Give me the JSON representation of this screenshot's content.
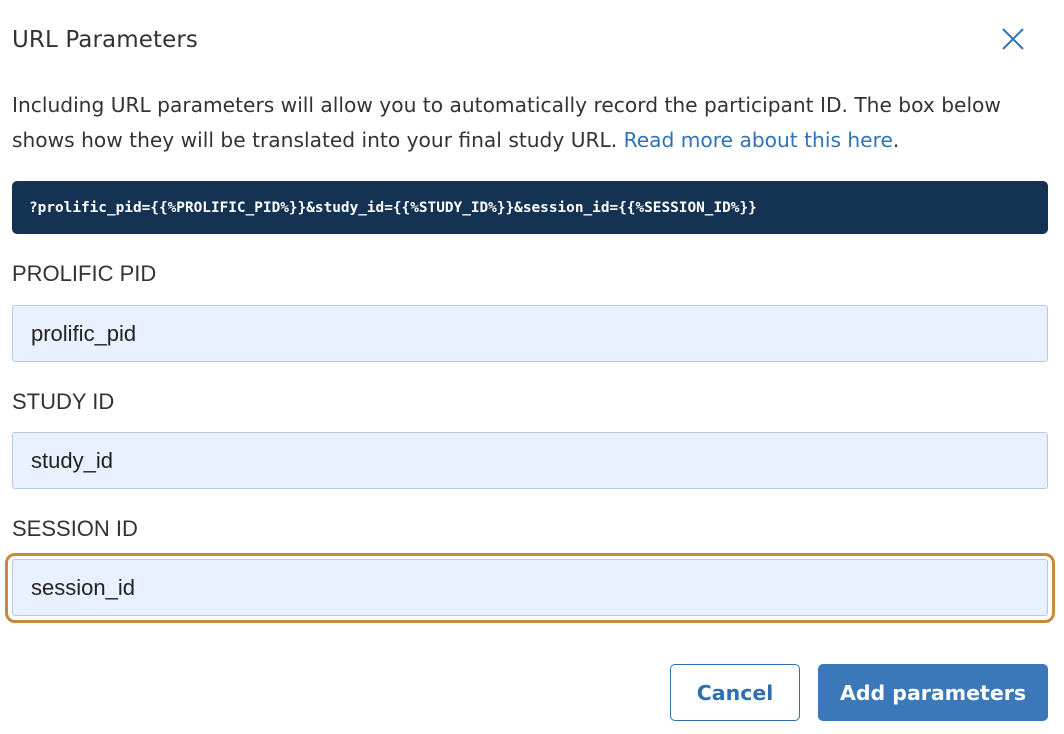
{
  "dialog": {
    "title": "URL Parameters",
    "close_icon": "close-icon",
    "description": "Including URL parameters will allow you to automatically record the participant ID. The box below shows how they will be translated into your final study URL. ",
    "read_more_link": "Read more about this here",
    "description_end": ".",
    "url_preview": "?prolific_pid={{%PROLIFIC_PID%}}&study_id={{%STUDY_ID%}}&session_id={{%SESSION_ID%}}"
  },
  "fields": {
    "prolific_pid": {
      "label": "PROLIFIC PID",
      "value": "prolific_pid"
    },
    "study_id": {
      "label": "STUDY ID",
      "value": "study_id"
    },
    "session_id": {
      "label": "SESSION ID",
      "value": "session_id",
      "focused": true
    }
  },
  "buttons": {
    "cancel": "Cancel",
    "add": "Add parameters"
  },
  "colors": {
    "link": "#2f73b6",
    "code_bg": "#143252",
    "input_bg": "#e9f0fe",
    "focus_ring": "#c8893c",
    "primary": "#3a78ba"
  }
}
